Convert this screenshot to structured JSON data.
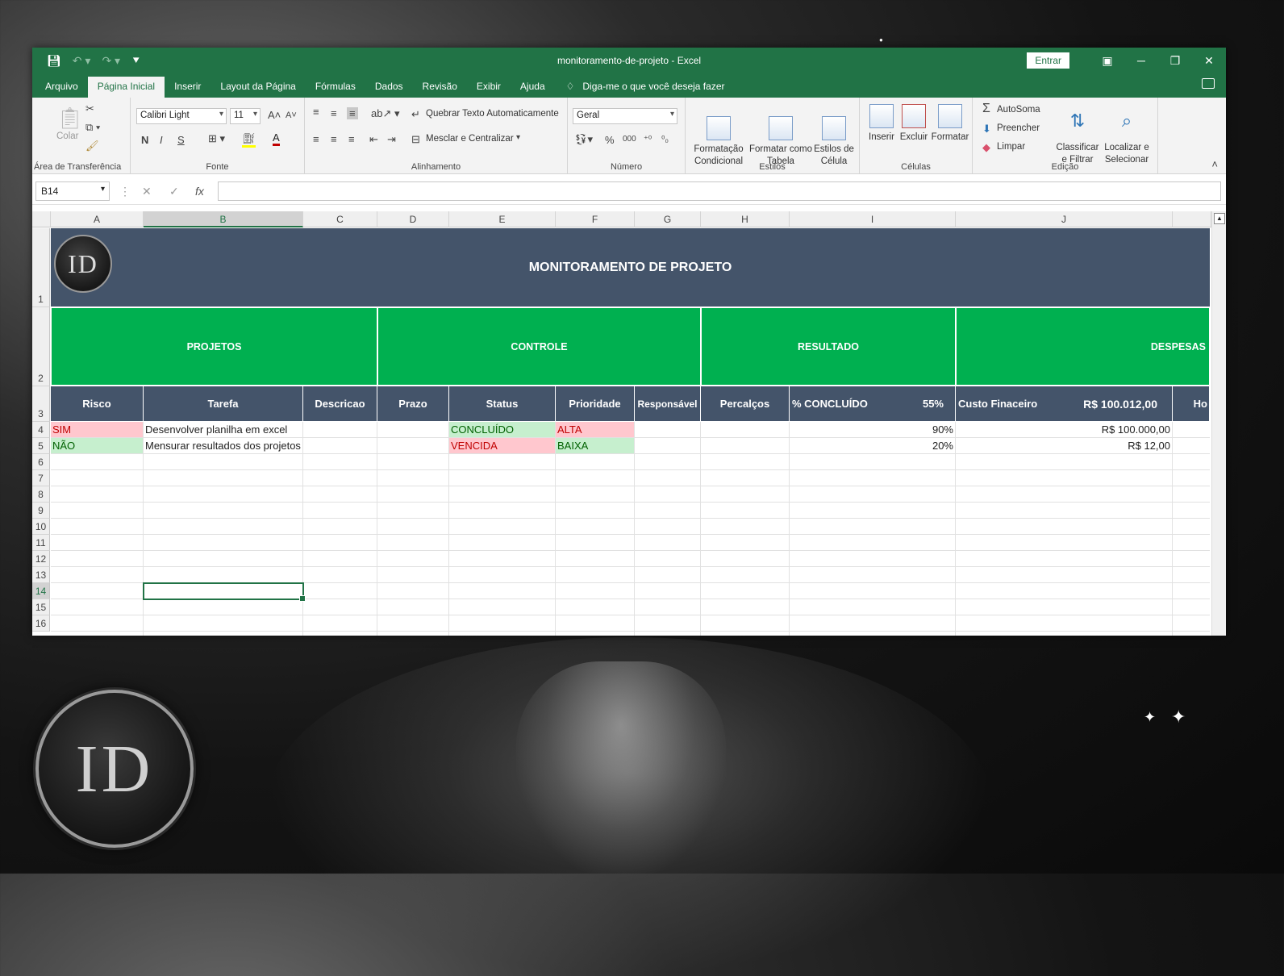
{
  "titlebar": {
    "title": "monitoramento-de-projeto  -  Excel",
    "signin": "Entrar"
  },
  "menu": {
    "tabs": [
      "Arquivo",
      "Página Inicial",
      "Inserir",
      "Layout da Página",
      "Fórmulas",
      "Dados",
      "Revisão",
      "Exibir",
      "Ajuda"
    ],
    "active": "Página Inicial",
    "tellme": "Diga-me o que você deseja fazer"
  },
  "ribbon": {
    "clipboard": {
      "paste": "Colar",
      "label": "Área de Transferência"
    },
    "font": {
      "name": "Calibri Light",
      "size": "11",
      "bold": "N",
      "italic": "I",
      "underline": "S",
      "label": "Fonte"
    },
    "alignment": {
      "wrap": "Quebrar Texto Automaticamente",
      "merge": "Mesclar e Centralizar",
      "label": "Alinhamento"
    },
    "number": {
      "format": "Geral",
      "percent": "%",
      "thousands": "000",
      "label": "Número"
    },
    "styles": {
      "conditional": "Formatação\nCondicional",
      "astable": "Formatar como\nTabela",
      "cellstyles": "Estilos de\nCélula",
      "label": "Estilos"
    },
    "cells": {
      "insert": "Inserir",
      "delete": "Excluir",
      "format": "Formatar",
      "label": "Células"
    },
    "editing": {
      "autosum": "AutoSoma",
      "fill": "Preencher",
      "clear": "Limpar",
      "sort": "Classificar\ne Filtrar",
      "find": "Localizar e\nSelecionar",
      "label": "Edição"
    }
  },
  "formula_bar": {
    "namebox": "B14",
    "fx": "fx",
    "value": ""
  },
  "sheet": {
    "columns": [
      "A",
      "B",
      "C",
      "D",
      "E",
      "F",
      "G",
      "H",
      "I",
      "J"
    ],
    "selected_column": "B",
    "rows": [
      "1",
      "2",
      "3",
      "4",
      "5",
      "6",
      "7",
      "8",
      "9",
      "10",
      "11",
      "12",
      "13",
      "14",
      "15",
      "16"
    ],
    "selected_row": "14",
    "banner_title": "MONITORAMENTO DE PROJETO",
    "logo_text": "ID",
    "sections": [
      "PROJETOS",
      "CONTROLE",
      "RESULTADO",
      "DESPESAS"
    ],
    "headers": {
      "risco": "Risco",
      "tarefa": "Tarefa",
      "descricao": "Descricao",
      "prazo": "Prazo",
      "status": "Status",
      "prioridade": "Prioridade",
      "responsavel": "Responsável",
      "percalcos": "Percalços",
      "concluido": "% CONCLUÍDO",
      "concluido_total": "55%",
      "custo": "Custo Finaceiro",
      "custo_total": "R$ 100.012,00",
      "extra": "Ho"
    },
    "data_rows": [
      {
        "risco": "SIM",
        "tarefa": "Desenvolver planilha em excel",
        "status": "CONCLUÍDO",
        "prioridade": "ALTA",
        "concluido": "90%",
        "custo": "R$ 100.000,00"
      },
      {
        "risco": "NÃO",
        "tarefa": "Mensurar resultados dos projetos",
        "status": "VENCIDA",
        "prioridade": "BAIXA",
        "concluido": "20%",
        "custo": "R$ 12,00"
      }
    ]
  },
  "watermark": {
    "text": "ID"
  },
  "colors": {
    "excel_green": "#217346",
    "header_slate": "#44546a",
    "section_green": "#00b050",
    "bad_fill": "#ffc7ce",
    "good_fill": "#c6efce"
  }
}
